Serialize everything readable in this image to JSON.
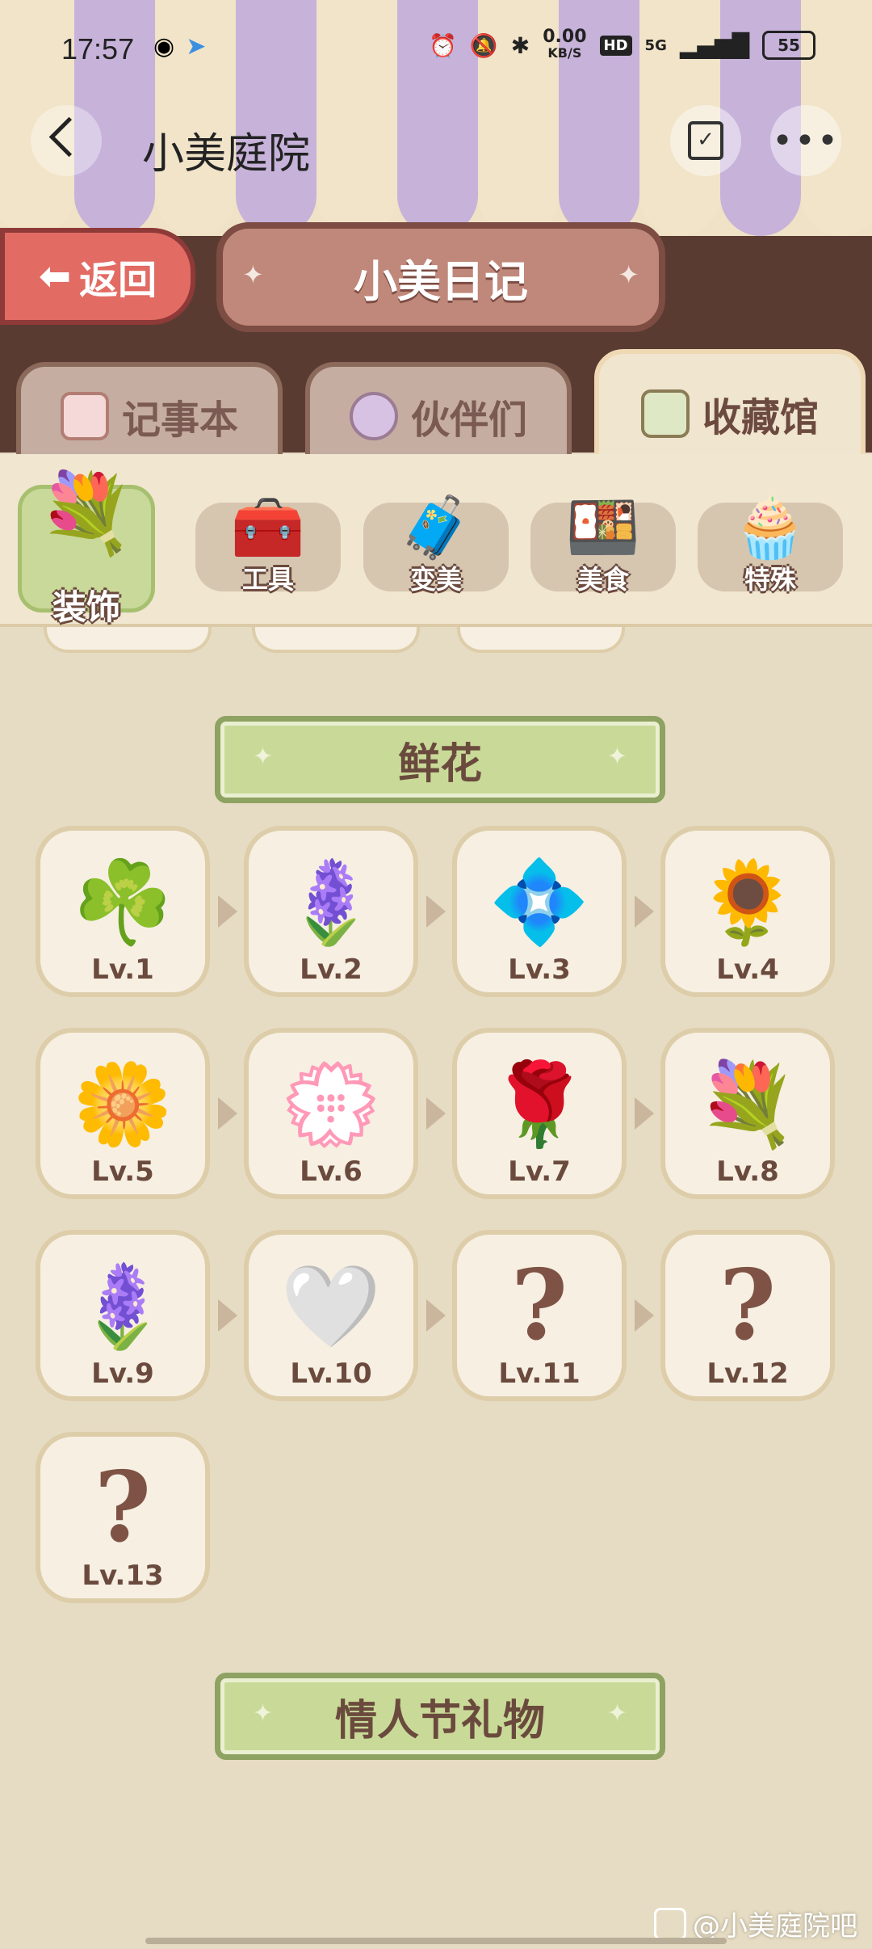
{
  "status_bar": {
    "time": "17:57",
    "net_speed_value": "0.00",
    "net_speed_unit": "KB/S",
    "hd_label": "HD",
    "network_label": "5G",
    "battery": "55"
  },
  "header": {
    "title": "小美庭院"
  },
  "nav": {
    "return_label": "返回",
    "diary_title": "小美日记"
  },
  "tabs": [
    {
      "label": "记事本",
      "icon": "notebook-icon",
      "active": false
    },
    {
      "label": "伙伴们",
      "icon": "partners-icon",
      "active": false
    },
    {
      "label": "收藏馆",
      "icon": "collection-icon",
      "active": true
    }
  ],
  "categories": [
    {
      "label": "装饰",
      "icon": "💐",
      "active": true
    },
    {
      "label": "工具",
      "icon": "🧰",
      "active": false
    },
    {
      "label": "变美",
      "icon": "🧳",
      "active": false
    },
    {
      "label": "美食",
      "icon": "🍱",
      "active": false
    },
    {
      "label": "特殊",
      "icon": "🧁",
      "active": false
    }
  ],
  "sections": {
    "flowers_title": "鲜花",
    "valentine_title": "情人节礼物"
  },
  "flower_items": [
    {
      "level": "Lv.1",
      "icon": "☘️"
    },
    {
      "level": "Lv.2",
      "icon": "🪻"
    },
    {
      "level": "Lv.3",
      "icon": "💠"
    },
    {
      "level": "Lv.4",
      "icon": "🌻"
    },
    {
      "level": "Lv.5",
      "icon": "🌼"
    },
    {
      "level": "Lv.6",
      "icon": "💮"
    },
    {
      "level": "Lv.7",
      "icon": "🌹"
    },
    {
      "level": "Lv.8",
      "icon": "💐"
    },
    {
      "level": "Lv.9",
      "icon": "🪻"
    },
    {
      "level": "Lv.10",
      "icon": "🤍"
    },
    {
      "level": "Lv.11",
      "icon": "?"
    },
    {
      "level": "Lv.12",
      "icon": "?"
    },
    {
      "level": "Lv.13",
      "icon": "?"
    }
  ],
  "watermark": "@小美庭院吧",
  "colors": {
    "awning_stripe": "#c7b2da",
    "band_brown": "#5a3b32",
    "return_red": "#e26b64",
    "section_green": "#c9da98",
    "card_bg": "#f6efe2"
  }
}
